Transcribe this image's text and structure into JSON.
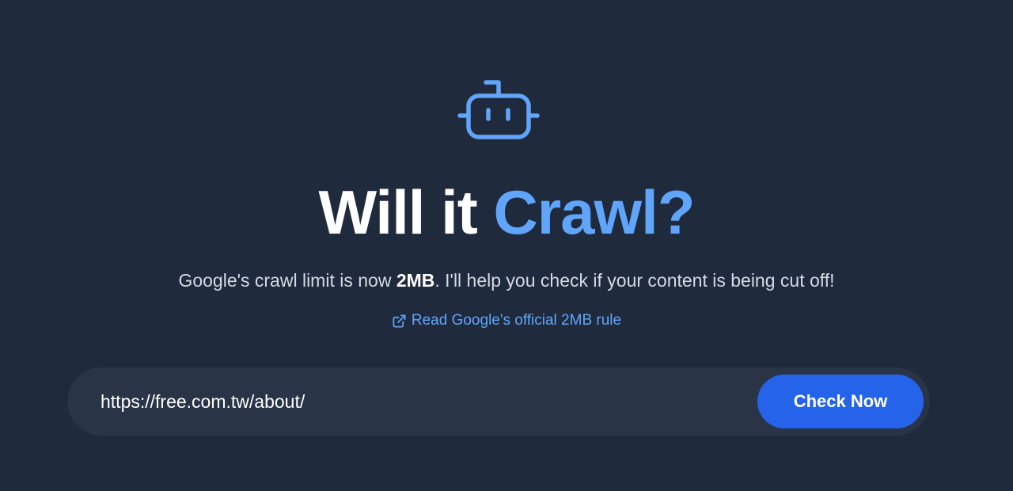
{
  "hero": {
    "icon": "robot-icon",
    "title_part1": "Will it ",
    "title_part2": "Crawl?",
    "subtitle_before": "Google's crawl limit is now ",
    "subtitle_bold": "2MB",
    "subtitle_after": ". I'll help you check if your content is being cut off!",
    "link_icon": "external-link-icon",
    "link_label": "Read Google's official 2MB rule"
  },
  "search": {
    "value": "https://free.com.tw/about/",
    "button_label": "Check Now"
  },
  "colors": {
    "background": "#1f2a3c",
    "accent": "#60a5fa",
    "button": "#2563eb",
    "input_bar": "#2a3447"
  }
}
